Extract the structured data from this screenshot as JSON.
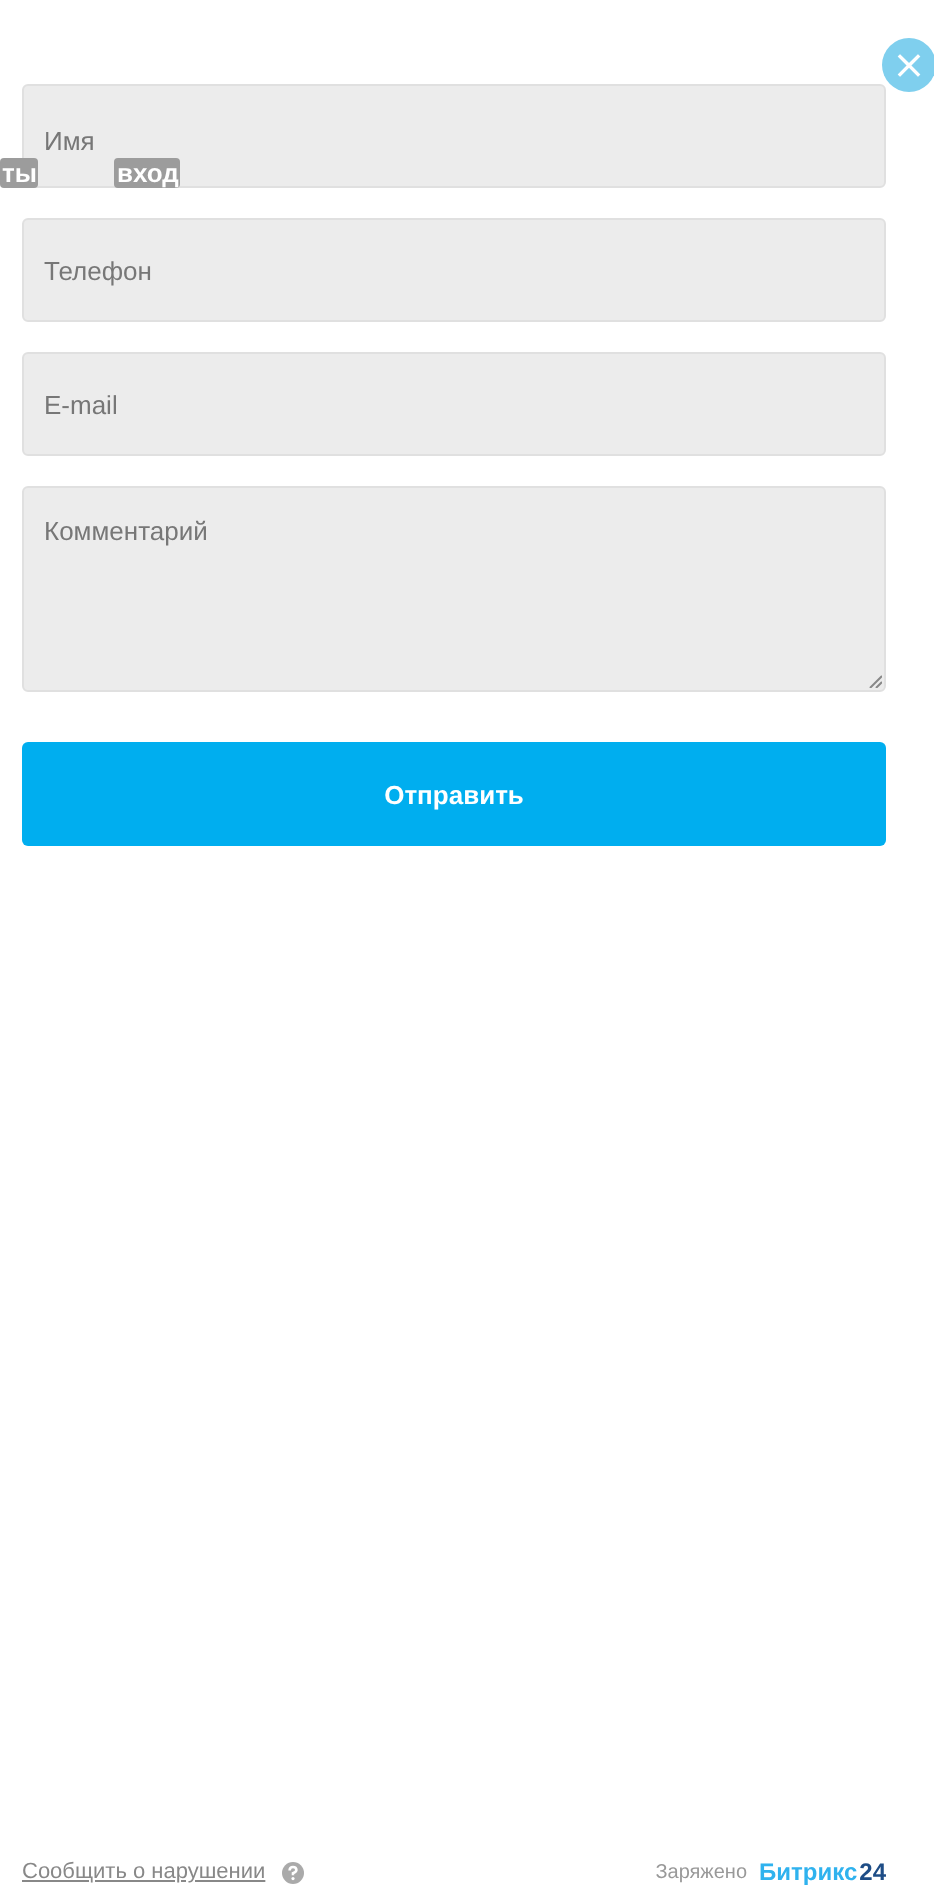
{
  "close_button": {
    "label": "×"
  },
  "overlay_texts": [
    "ты",
    "вход"
  ],
  "fields": [
    {
      "kind": "input",
      "placeholder": "Имя"
    },
    {
      "kind": "input",
      "placeholder": "Телефон"
    },
    {
      "kind": "input",
      "placeholder": "E-mail"
    },
    {
      "kind": "textarea",
      "placeholder": "Комментарий"
    }
  ],
  "submit_button": "Отправить",
  "footer": {
    "report_link": "Сообщить о нарушении",
    "powered_by": "Заряжено",
    "brand_name": "Битрикс",
    "brand_number": "24"
  }
}
